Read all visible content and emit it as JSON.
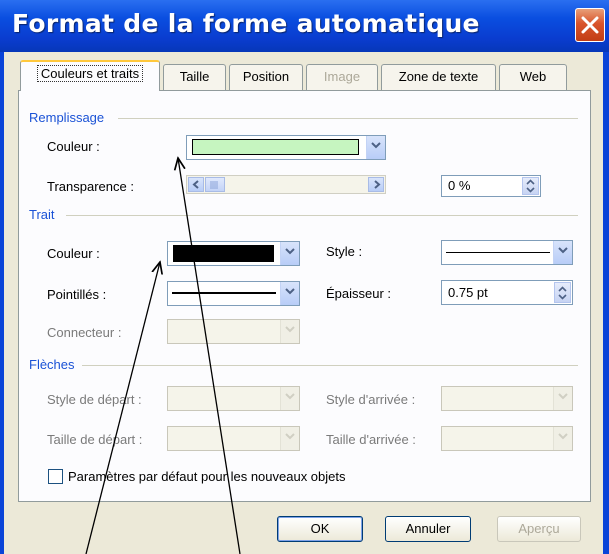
{
  "window": {
    "title": "Format de la forme automatique"
  },
  "tabs": [
    {
      "label": "Couleurs et traits",
      "active": true,
      "enabled": true
    },
    {
      "label": "Taille",
      "active": false,
      "enabled": true
    },
    {
      "label": "Position",
      "active": false,
      "enabled": true
    },
    {
      "label": "Image",
      "active": false,
      "enabled": false
    },
    {
      "label": "Zone de texte",
      "active": false,
      "enabled": true
    },
    {
      "label": "Web",
      "active": false,
      "enabled": true
    }
  ],
  "remplissage": {
    "section": "Remplissage",
    "couleur_label": "Couleur :",
    "couleur_value": "#c6f5c0",
    "transparence_label": "Transparence :",
    "transparence_percent": "0 %"
  },
  "trait": {
    "section": "Trait",
    "couleur_label": "Couleur :",
    "couleur_value": "#000000",
    "style_label": "Style :",
    "pointilles_label": "Pointillés :",
    "epaisseur_label": "Épaisseur :",
    "epaisseur_value": "0.75 pt",
    "connecteur_label": "Connecteur :"
  },
  "fleches": {
    "section": "Flèches",
    "style_depart_label": "Style de départ :",
    "style_arrivee_label": "Style d'arrivée :",
    "taille_depart_label": "Taille de départ :",
    "taille_arrivee_label": "Taille d'arrivée :"
  },
  "default_checkbox": {
    "label": "Paramètres par défaut pour les nouveaux objets",
    "checked": false
  },
  "buttons": {
    "ok": "OK",
    "annuler": "Annuler",
    "apercu": "Aperçu"
  },
  "colors": {
    "titlebar": "#0a4ee0",
    "section_header": "#1a52d6",
    "tab_highlight": "#ffc83c"
  }
}
